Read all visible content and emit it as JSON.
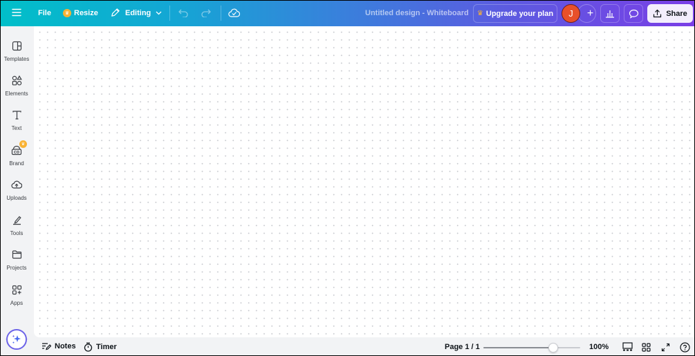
{
  "topbar": {
    "menu_icon": "hamburger-menu-icon",
    "file_label": "File",
    "resize_label": "Resize",
    "resize_icon": "crown-icon",
    "editing_label": "Editing",
    "editing_icon": "pencil-icon",
    "undo_icon": "undo-icon",
    "redo_icon": "redo-icon",
    "save_status_icon": "cloud-check-icon",
    "design_title": "Untitled design - Whiteboard",
    "upgrade_label": "Upgrade your plan",
    "avatar_initial": "J",
    "add_collaborator": "+",
    "analytics_icon": "bar-chart-icon",
    "comment_icon": "comment-icon",
    "share_label": "Share",
    "share_icon": "share-upload-icon"
  },
  "sidebar": {
    "items": [
      {
        "label": "Templates",
        "icon": "templates-icon"
      },
      {
        "label": "Elements",
        "icon": "elements-icon"
      },
      {
        "label": "Text",
        "icon": "text-icon"
      },
      {
        "label": "Brand",
        "icon": "brand-icon",
        "premium": true
      },
      {
        "label": "Uploads",
        "icon": "upload-cloud-icon"
      },
      {
        "label": "Tools",
        "icon": "tools-pen-icon"
      },
      {
        "label": "Projects",
        "icon": "folder-icon"
      },
      {
        "label": "Apps",
        "icon": "apps-icon"
      }
    ],
    "magic_icon": "magic-sparkle-icon"
  },
  "bottombar": {
    "notes_label": "Notes",
    "timer_label": "Timer",
    "page_label": "Page 1 / 1",
    "zoom_label": "100%",
    "zoom_slider_fraction": 0.72
  },
  "colors": {
    "gradient_start": "#01bfc9",
    "gradient_end": "#7a3ee6",
    "avatar": "#e8502a",
    "premium": "#f9b233"
  }
}
